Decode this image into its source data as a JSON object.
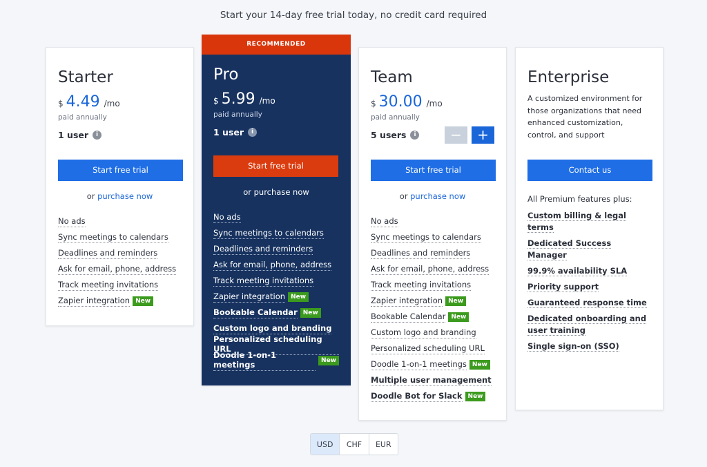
{
  "headline": "Start your 14-day free trial today, no credit card required",
  "colors": {
    "accent": "#1f6ee5",
    "pro_bg": "#17325f",
    "recommended": "#d9360b",
    "new_badge": "#3c9b1e"
  },
  "new_badge": "New",
  "or_text": "or",
  "starter": {
    "name": "Starter",
    "currency": "$",
    "amount": "4.49",
    "per": "/mo",
    "paid": "paid annually",
    "users": "1 user",
    "info_icon": "i",
    "cta": "Start free trial",
    "purchase": "purchase now",
    "features": [
      "No ads",
      "Sync meetings to calendars",
      "Deadlines and reminders",
      "Ask for email, phone, address",
      "Track meeting invitations",
      "Zapier integration"
    ]
  },
  "pro": {
    "banner": "RECOMMENDED",
    "name": "Pro",
    "currency": "$",
    "amount": "5.99",
    "per": "/mo",
    "paid": "paid annually",
    "users": "1 user",
    "info_icon": "i",
    "cta": "Start free trial",
    "purchase": "purchase now",
    "features": [
      "No ads",
      "Sync meetings to calendars",
      "Deadlines and reminders",
      "Ask for email, phone, address",
      "Track meeting invitations",
      "Zapier integration",
      "Bookable Calendar",
      "Custom logo and branding",
      "Personalized scheduling URL",
      "Doodle 1-on-1 meetings"
    ]
  },
  "team": {
    "name": "Team",
    "currency": "$",
    "amount": "30.00",
    "per": "/mo",
    "paid": "paid annually",
    "users": "5 users",
    "info_icon": "i",
    "minus": "−",
    "plus": "+",
    "cta": "Start free trial",
    "purchase": "purchase now",
    "features": [
      "No ads",
      "Sync meetings to calendars",
      "Deadlines and reminders",
      "Ask for email, phone, address",
      "Track meeting invitations",
      "Zapier integration",
      "Bookable Calendar",
      "Custom logo and branding",
      "Personalized scheduling URL",
      "Doodle 1-on-1 meetings",
      "Multiple user management",
      "Doodle Bot for Slack"
    ]
  },
  "enterprise": {
    "name": "Enterprise",
    "description": "A customized environment for those organizations that need enhanced customization, control, and support",
    "cta": "Contact us",
    "intro": "All Premium features plus:",
    "features": [
      "Custom billing & legal terms",
      "Dedicated Success Manager",
      "99.9% availability SLA",
      "Priority support",
      "Guaranteed response time",
      "Dedicated onboarding and user training",
      "Single sign-on (SSO)"
    ]
  },
  "currency_toggle": {
    "options": [
      "USD",
      "CHF",
      "EUR"
    ],
    "selected": "USD"
  }
}
